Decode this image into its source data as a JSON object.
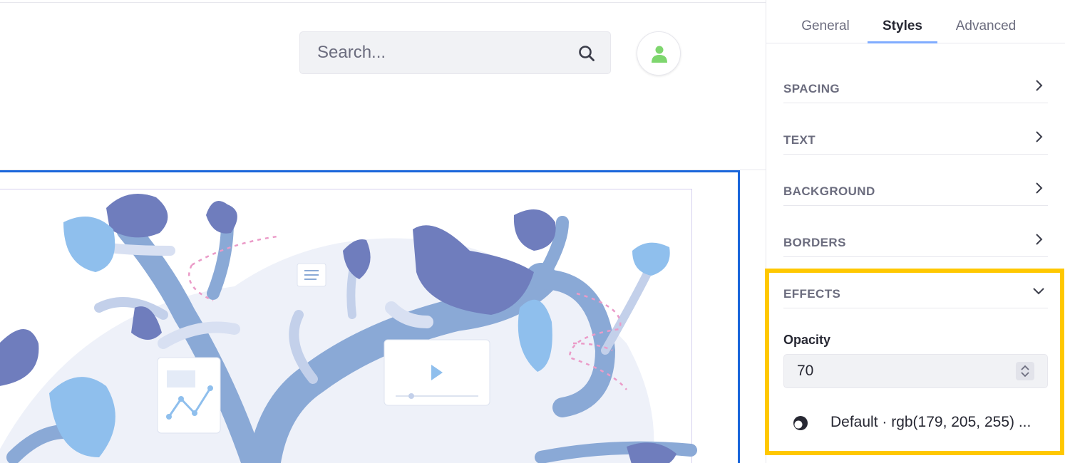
{
  "header": {
    "search": {
      "placeholder": "Search...",
      "value": ""
    }
  },
  "panel": {
    "tabs": [
      {
        "label": "General",
        "active": false
      },
      {
        "label": "Styles",
        "active": true
      },
      {
        "label": "Advanced",
        "active": false
      }
    ],
    "sections": [
      {
        "label": "SPACING",
        "expanded": false
      },
      {
        "label": "TEXT",
        "expanded": false
      },
      {
        "label": "BACKGROUND",
        "expanded": false
      },
      {
        "label": "BORDERS",
        "expanded": false
      },
      {
        "label": "EFFECTS",
        "expanded": true
      }
    ],
    "effects": {
      "opacity_label": "Opacity",
      "opacity_value": "70",
      "color_value": "Default · rgb(179, 205, 255) ..."
    }
  },
  "colors": {
    "accent": "#1a66db",
    "tab_underline": "#80acff",
    "highlight": "#ffc800",
    "avatar": "#7ed66e",
    "leaf_dark": "#6f7dbd",
    "leaf_light": "#8fbfed",
    "branch": "#8aa9d6"
  },
  "icons": {
    "search": "search-icon",
    "avatar": "user-icon",
    "chevron_right": "chevron-right-icon",
    "chevron_down": "chevron-down-icon",
    "stepper": "stepper-icon",
    "color": "color-picker-icon"
  }
}
